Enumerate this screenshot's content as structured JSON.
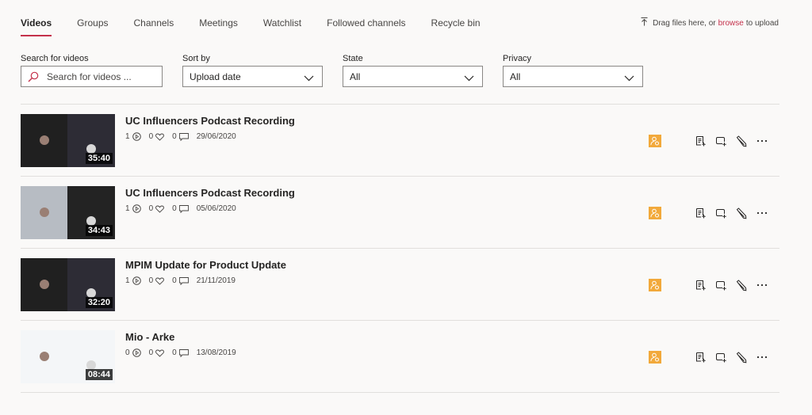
{
  "tabs": [
    {
      "label": "Videos",
      "active": true
    },
    {
      "label": "Groups",
      "active": false
    },
    {
      "label": "Channels",
      "active": false
    },
    {
      "label": "Meetings",
      "active": false
    },
    {
      "label": "Watchlist",
      "active": false
    },
    {
      "label": "Followed channels",
      "active": false
    },
    {
      "label": "Recycle bin",
      "active": false
    }
  ],
  "upload": {
    "icon": "upload-icon",
    "prefix": "Drag files here, or",
    "link": "browse",
    "suffix": "to upload"
  },
  "filters": {
    "search": {
      "label": "Search for videos",
      "placeholder": "Search for videos ...",
      "icon": "search-icon"
    },
    "sort": {
      "label": "Sort by",
      "value": "Upload date"
    },
    "state": {
      "label": "State",
      "value": "All"
    },
    "privacy": {
      "label": "Privacy",
      "value": "All"
    }
  },
  "videos": [
    {
      "title": "UC Influencers Podcast Recording",
      "views": "1",
      "likes": "0",
      "comments": "0",
      "date": "29/06/2020",
      "duration": "35:40"
    },
    {
      "title": "UC Influencers Podcast Recording",
      "views": "1",
      "likes": "0",
      "comments": "0",
      "date": "05/06/2020",
      "duration": "34:43"
    },
    {
      "title": "MPIM Update for Product Update",
      "views": "1",
      "likes": "0",
      "comments": "0",
      "date": "21/11/2019",
      "duration": "32:20"
    },
    {
      "title": "Mio - Arke",
      "views": "0",
      "likes": "0",
      "comments": "0",
      "date": "13/08/2019",
      "duration": "08:44"
    }
  ],
  "colors": {
    "accent": "#c4314b",
    "permission_badge": "#f2a93b"
  }
}
